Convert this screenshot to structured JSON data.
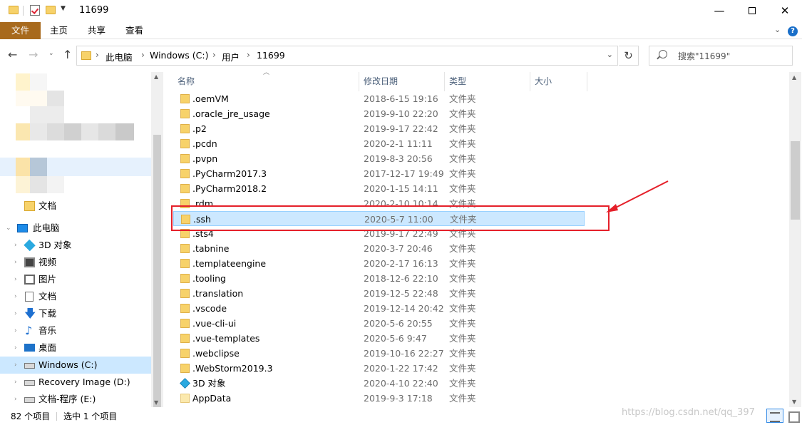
{
  "window": {
    "title": "11699",
    "minimize": "—",
    "close": "✕"
  },
  "ribbon": {
    "tabs": [
      "文件",
      "主页",
      "共享",
      "查看"
    ],
    "collapse_icon": "chevron-down-icon",
    "help": "?"
  },
  "address": {
    "back": "←",
    "forward": "→",
    "recent": "⌄",
    "up": "↑",
    "crumbs": [
      "此电脑",
      "Windows (C:)",
      "用户",
      "11699"
    ],
    "separator": "›",
    "dropdown": "⌄",
    "refresh": "↻",
    "search_placeholder": "搜索\"11699\""
  },
  "nav": {
    "items": [
      {
        "label": "文档",
        "icon": "folder-icon"
      },
      {
        "label": "此电脑",
        "icon": "pc-icon"
      },
      {
        "label": "3D 对象",
        "icon": "3d-objects-icon"
      },
      {
        "label": "视频",
        "icon": "video-icon"
      },
      {
        "label": "图片",
        "icon": "pictures-icon"
      },
      {
        "label": "文档",
        "icon": "documents-icon"
      },
      {
        "label": "下载",
        "icon": "download-icon"
      },
      {
        "label": "音乐",
        "icon": "music-icon"
      },
      {
        "label": "桌面",
        "icon": "desktop-icon"
      },
      {
        "label": "Windows (C:)",
        "icon": "drive-icon",
        "selected": true
      },
      {
        "label": "Recovery Image (D:)",
        "icon": "drive-icon"
      },
      {
        "label": "文档-程序 (E:)",
        "icon": "drive-icon"
      }
    ]
  },
  "columns": {
    "name": "名称",
    "date": "修改日期",
    "type": "类型",
    "size": "大小"
  },
  "files": [
    {
      "name": ".oemVM",
      "date": "2018-6-15 19:16",
      "type": "文件夹"
    },
    {
      "name": ".oracle_jre_usage",
      "date": "2019-9-10 22:20",
      "type": "文件夹"
    },
    {
      "name": ".p2",
      "date": "2019-9-17 22:42",
      "type": "文件夹"
    },
    {
      "name": ".pcdn",
      "date": "2020-2-1 11:11",
      "type": "文件夹"
    },
    {
      "name": ".pvpn",
      "date": "2019-8-3 20:56",
      "type": "文件夹"
    },
    {
      "name": ".PyCharm2017.3",
      "date": "2017-12-17 19:49",
      "type": "文件夹"
    },
    {
      "name": ".PyCharm2018.2",
      "date": "2020-1-15 14:11",
      "type": "文件夹"
    },
    {
      "name": ".rdm",
      "date": "2020-2-10 10:14",
      "type": "文件夹"
    },
    {
      "name": ".ssh",
      "date": "2020-5-7 11:00",
      "type": "文件夹",
      "selected": true
    },
    {
      "name": ".sts4",
      "date": "2019-9-17 22:49",
      "type": "文件夹"
    },
    {
      "name": ".tabnine",
      "date": "2020-3-7 20:46",
      "type": "文件夹"
    },
    {
      "name": ".templateengine",
      "date": "2020-2-17 16:13",
      "type": "文件夹"
    },
    {
      "name": ".tooling",
      "date": "2018-12-6 22:10",
      "type": "文件夹"
    },
    {
      "name": ".translation",
      "date": "2019-12-5 22:48",
      "type": "文件夹"
    },
    {
      "name": ".vscode",
      "date": "2019-12-14 20:42",
      "type": "文件夹"
    },
    {
      "name": ".vue-cli-ui",
      "date": "2020-5-6 20:55",
      "type": "文件夹"
    },
    {
      "name": ".vue-templates",
      "date": "2020-5-6 9:47",
      "type": "文件夹"
    },
    {
      "name": ".webclipse",
      "date": "2019-10-16 22:27",
      "type": "文件夹"
    },
    {
      "name": ".WebStorm2019.3",
      "date": "2020-1-22 17:42",
      "type": "文件夹"
    },
    {
      "name": "3D 对象",
      "date": "2020-4-10 22:40",
      "type": "文件夹",
      "icon": "3d-objects-icon"
    },
    {
      "name": "AppData",
      "date": "2019-9-3 17:18",
      "type": "文件夹",
      "icon": "appdata-folder-icon"
    }
  ],
  "status": {
    "count": "82 个项目",
    "selected": "选中 1 个项目",
    "watermark": "https://blog.csdn.net/qq_397"
  },
  "colors": {
    "file_tab": "#a86a1d",
    "selection": "#cce8ff",
    "annotation": "#e5202a"
  }
}
